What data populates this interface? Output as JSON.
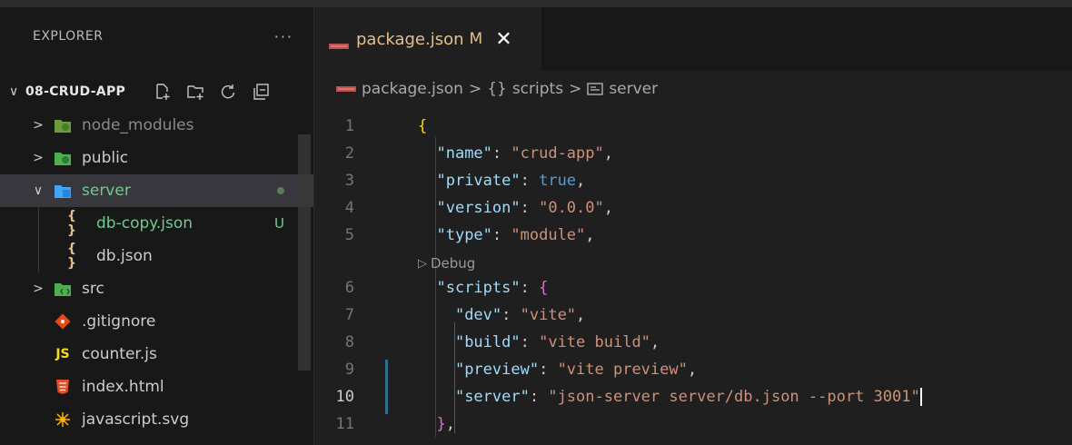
{
  "sidebar": {
    "title": "EXPLORER",
    "more": "···",
    "project": {
      "chevron": "∨",
      "name": "08-CRUD-APP"
    },
    "items": [
      {
        "label": "node_modules",
        "chevron": ">",
        "icon": "folder-node-icon",
        "color": "#8a8a8a"
      },
      {
        "label": "public",
        "chevron": ">",
        "icon": "folder-public-icon",
        "color": "#cccccc"
      },
      {
        "label": "server",
        "chevron": "∨",
        "icon": "folder-server-icon",
        "color": "#73c991",
        "selected": true
      },
      {
        "label": "db-copy.json",
        "icon": "json-braces-icon",
        "color": "#73c991",
        "badge": "U"
      },
      {
        "label": "db.json",
        "icon": "json-braces-icon",
        "color": "#cccccc"
      },
      {
        "label": "src",
        "chevron": ">",
        "icon": "folder-src-icon",
        "color": "#cccccc"
      },
      {
        "label": ".gitignore",
        "icon": "git-icon",
        "color": "#cccccc"
      },
      {
        "label": "counter.js",
        "icon": "js-icon",
        "icon_text": "JS",
        "color": "#cccccc"
      },
      {
        "label": "index.html",
        "icon": "html-icon",
        "color": "#cccccc"
      },
      {
        "label": "javascript.svg",
        "icon": "svg-icon",
        "color": "#cccccc"
      }
    ]
  },
  "tab": {
    "label": "package.json",
    "modified": "M",
    "close": "✕"
  },
  "breadcrumb": {
    "file": "package.json",
    "sep": ">",
    "braces": "{}",
    "scope": "scripts",
    "leaf": "server"
  },
  "editor": {
    "codelens": "Debug",
    "lines": [
      {
        "n": "1",
        "parts": [
          [
            "brace",
            "{"
          ]
        ]
      },
      {
        "n": "2",
        "parts": [
          [
            "p",
            "  "
          ],
          [
            "k",
            "\"name\""
          ],
          [
            "p",
            ": "
          ],
          [
            "s",
            "\"crud-app\""
          ],
          [
            "p",
            ","
          ]
        ]
      },
      {
        "n": "3",
        "parts": [
          [
            "p",
            "  "
          ],
          [
            "k",
            "\"private\""
          ],
          [
            "p",
            ": "
          ],
          [
            "b",
            "true"
          ],
          [
            "p",
            ","
          ]
        ]
      },
      {
        "n": "4",
        "parts": [
          [
            "p",
            "  "
          ],
          [
            "k",
            "\"version\""
          ],
          [
            "p",
            ": "
          ],
          [
            "s",
            "\"0.0.0\""
          ],
          [
            "p",
            ","
          ]
        ]
      },
      {
        "n": "5",
        "parts": [
          [
            "p",
            "  "
          ],
          [
            "k",
            "\"type\""
          ],
          [
            "p",
            ": "
          ],
          [
            "s",
            "\"module\""
          ],
          [
            "p",
            ","
          ]
        ]
      },
      {
        "n": "6",
        "parts": [
          [
            "p",
            "  "
          ],
          [
            "k",
            "\"scripts\""
          ],
          [
            "p",
            ": "
          ],
          [
            "brace2",
            "{"
          ]
        ]
      },
      {
        "n": "7",
        "parts": [
          [
            "p",
            "    "
          ],
          [
            "k",
            "\"dev\""
          ],
          [
            "p",
            ": "
          ],
          [
            "s",
            "\"vite\""
          ],
          [
            "p",
            ","
          ]
        ]
      },
      {
        "n": "8",
        "parts": [
          [
            "p",
            "    "
          ],
          [
            "k",
            "\"build\""
          ],
          [
            "p",
            ": "
          ],
          [
            "s",
            "\"vite build\""
          ],
          [
            "p",
            ","
          ]
        ]
      },
      {
        "n": "9",
        "parts": [
          [
            "p",
            "    "
          ],
          [
            "k",
            "\"preview\""
          ],
          [
            "p",
            ": "
          ],
          [
            "s",
            "\"vite preview\""
          ],
          [
            "p",
            ","
          ]
        ]
      },
      {
        "n": "10",
        "active": true,
        "parts": [
          [
            "p",
            "    "
          ],
          [
            "k",
            "\"server\""
          ],
          [
            "p",
            ": "
          ],
          [
            "s",
            "\"json-server server/db.json --port 3001\""
          ]
        ]
      },
      {
        "n": "11",
        "parts": [
          [
            "p",
            "  "
          ],
          [
            "brace2",
            "}"
          ],
          [
            "p",
            ","
          ]
        ]
      }
    ]
  },
  "colors": {
    "accent_modified": "#e2c08d",
    "untracked": "#73c991",
    "json_key": "#9cdcfe",
    "json_string": "#ce9178"
  }
}
